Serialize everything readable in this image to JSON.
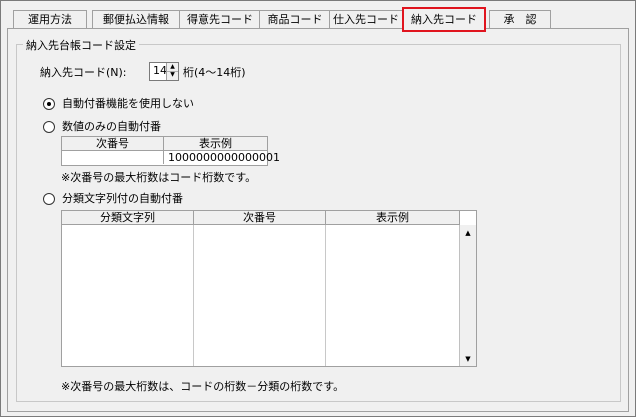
{
  "tabs": [
    {
      "label": "運用方法"
    },
    {
      "label": "郵便払込情報"
    },
    {
      "label": "得意先コード"
    },
    {
      "label": "商品コード"
    },
    {
      "label": "仕入先コード"
    },
    {
      "label": "納入先コード"
    },
    {
      "label": "承　認"
    }
  ],
  "group_title": "納入先台帳コード設定",
  "code_label": "納入先コード(N):",
  "code_value": "14",
  "code_hint": "桁(4～14桁)",
  "options": [
    {
      "label": "自動付番機能を使用しない",
      "checked": true
    },
    {
      "label": "数値のみの自動付番",
      "checked": false
    },
    {
      "label": "分類文字列付の自動付番",
      "checked": false
    }
  ],
  "numeric_table": {
    "headers": [
      "次番号",
      "表示例"
    ],
    "row": [
      "",
      "1000000000000001"
    ]
  },
  "numeric_note": "※次番号の最大桁数はコード桁数です。",
  "class_table": {
    "headers": [
      "分類文字列",
      "次番号",
      "表示例"
    ]
  },
  "class_note": "※次番号の最大桁数は、コードの桁数－分類の桁数です。"
}
